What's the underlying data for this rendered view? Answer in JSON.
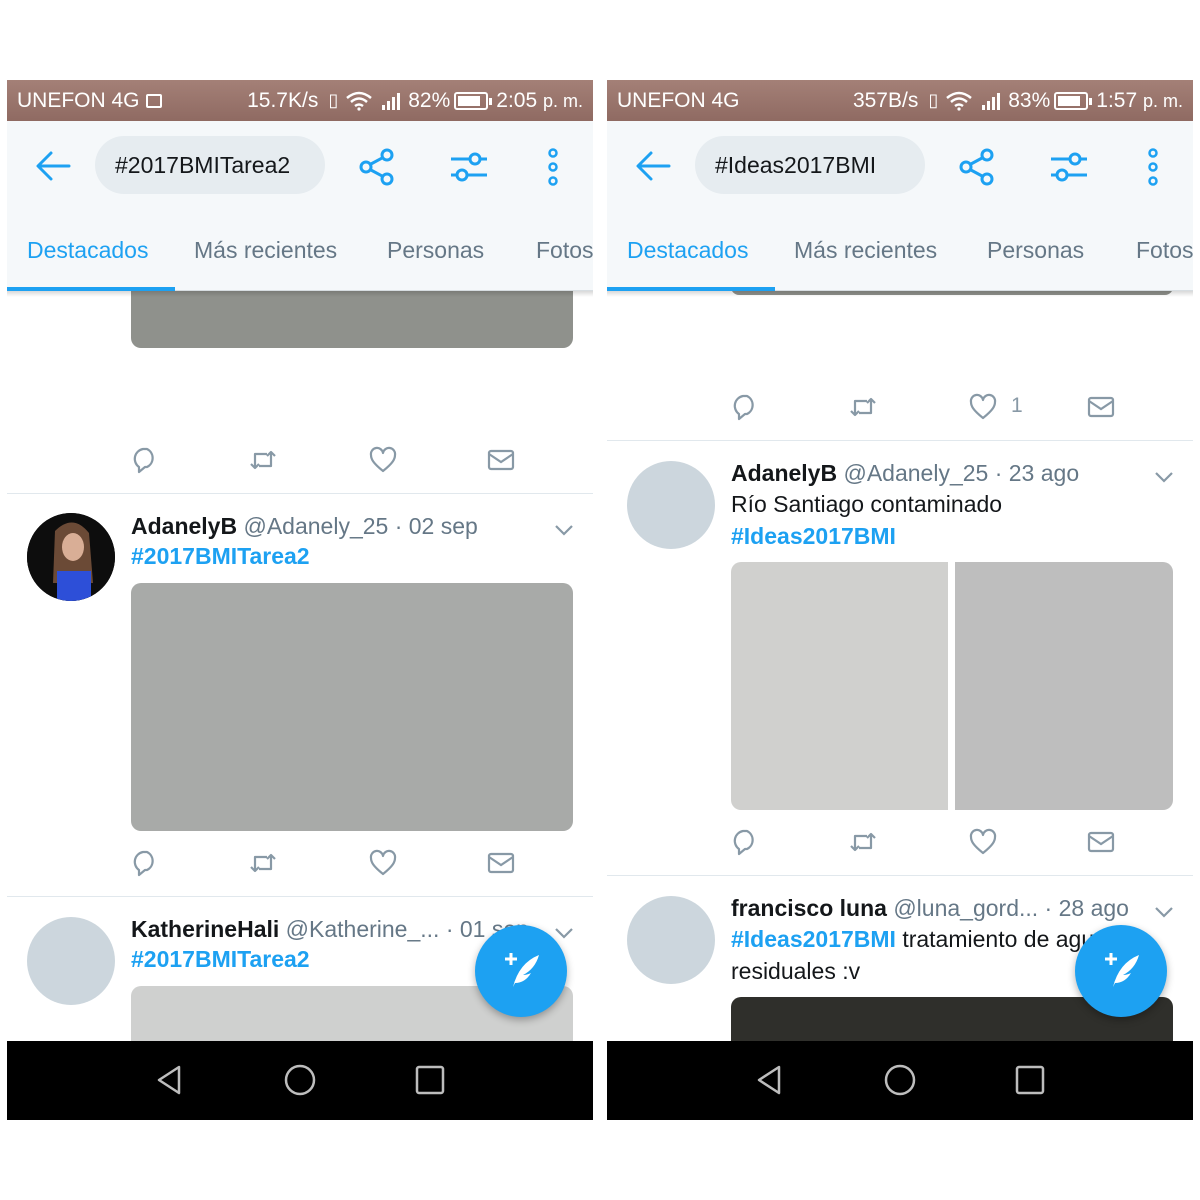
{
  "left": {
    "status": {
      "carrier": "UNEFON 4G",
      "speed": "15.7K/s",
      "battery": "82%",
      "battery_level": 0.82,
      "time": "2:05",
      "ampm": "p. m."
    },
    "search": {
      "query": "#2017BMITarea2"
    },
    "tabs": [
      "Destacados",
      "Más recientes",
      "Personas",
      "Fotos"
    ],
    "tweets": [
      {
        "name": "AdanelyB",
        "handle": "@Adanely_25",
        "time": "· 02 sep",
        "hashtag": "#2017BMITarea2"
      },
      {
        "name": "KatherineHali",
        "handle": "@Katherine_...",
        "time": "· 01 sep",
        "hashtag": "#2017BMITarea2"
      }
    ]
  },
  "right": {
    "status": {
      "carrier": "UNEFON 4G",
      "speed": "357B/s",
      "battery": "83%",
      "battery_level": 0.83,
      "time": "1:57",
      "ampm": "p. m."
    },
    "search": {
      "query": "#Ideas2017BMI"
    },
    "tabs": [
      "Destacados",
      "Más recientes",
      "Personas",
      "Fotos"
    ],
    "top_like_count": "1",
    "tweets": [
      {
        "name": "AdanelyB",
        "handle": "@Adanely_25",
        "time": "· 23 ago",
        "text": "Río Santiago contaminado",
        "hashtag": "#Ideas2017BMI"
      },
      {
        "name": "francisco luna",
        "handle": "@luna_gord...",
        "time": "· 28 ago",
        "hashtag": "#Ideas2017BMI",
        "text": "tratamiento de aguas residuales :v"
      }
    ]
  },
  "icons": {
    "back": "arrow-left-icon",
    "share": "share-icon",
    "filter": "filter-icon",
    "more": "more-vertical-icon",
    "reply": "reply-icon",
    "retweet": "retweet-icon",
    "like": "heart-icon",
    "dm": "envelope-icon",
    "compose": "compose-tweet-icon",
    "nav": [
      "nav-back-icon",
      "nav-home-icon",
      "nav-recents-icon"
    ]
  },
  "colors": {
    "accent": "#1da1f2",
    "status_bar": "#9a756c",
    "nav_bar": "#000000"
  }
}
